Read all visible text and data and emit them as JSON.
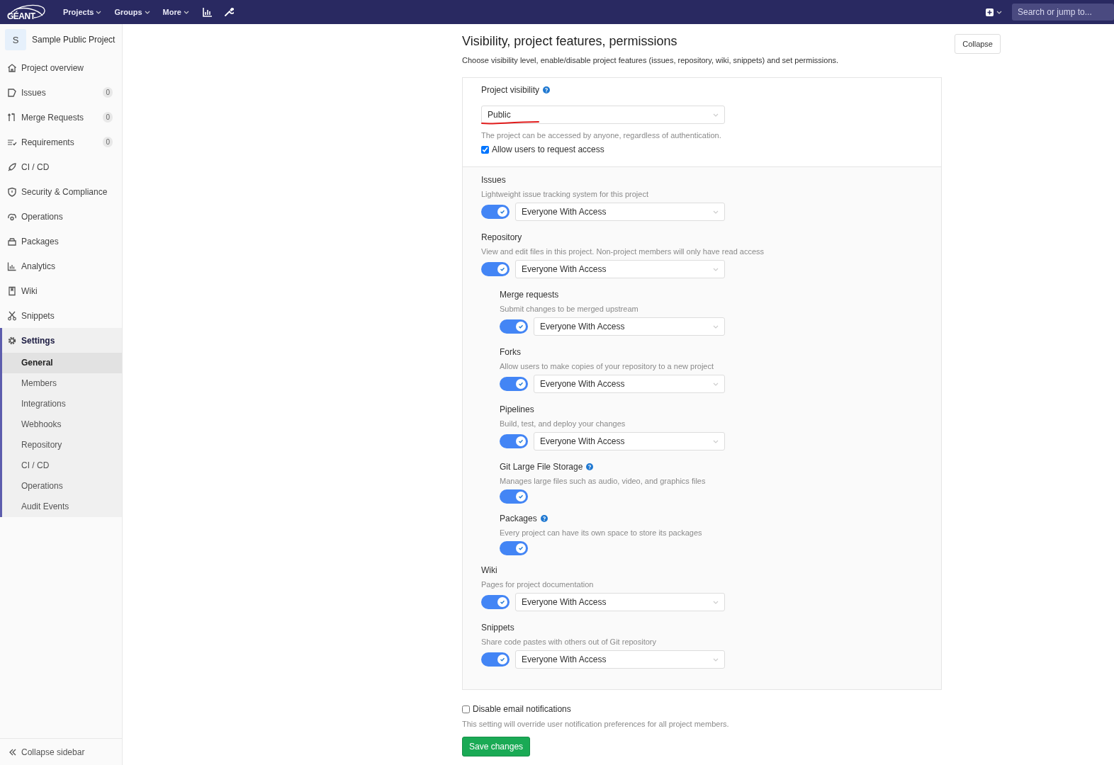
{
  "topbar": {
    "logo": "GÉANT",
    "nav": [
      {
        "label": "Projects"
      },
      {
        "label": "Groups"
      },
      {
        "label": "More"
      }
    ],
    "search": {
      "placeholder": "Search or jump to..."
    }
  },
  "sidebar": {
    "project": {
      "avatar": "S",
      "name": "Sample Public Project"
    },
    "items": [
      {
        "label": "Project overview",
        "selected": false
      },
      {
        "label": "Issues",
        "count": "0",
        "selected": false
      },
      {
        "label": "Merge Requests",
        "count": "0",
        "selected": false
      },
      {
        "label": "Requirements",
        "count": "0",
        "selected": false
      },
      {
        "label": "CI / CD",
        "selected": false
      },
      {
        "label": "Security & Compliance",
        "selected": false
      },
      {
        "label": "Operations",
        "selected": false
      },
      {
        "label": "Packages",
        "selected": false
      },
      {
        "label": "Analytics",
        "selected": false
      },
      {
        "label": "Wiki",
        "selected": false
      },
      {
        "label": "Snippets",
        "selected": false
      },
      {
        "label": "Settings",
        "selected": true,
        "children": [
          {
            "label": "General",
            "selected": true
          },
          {
            "label": "Members",
            "selected": false
          },
          {
            "label": "Integrations",
            "selected": false
          },
          {
            "label": "Webhooks",
            "selected": false
          },
          {
            "label": "Repository",
            "selected": false
          },
          {
            "label": "CI / CD",
            "selected": false
          },
          {
            "label": "Operations",
            "selected": false
          },
          {
            "label": "Audit Events",
            "selected": false
          }
        ]
      }
    ],
    "collapse": "Collapse sidebar"
  },
  "section": {
    "title": "Visibility, project features, permissions",
    "description": "Choose visibility level, enable/disable project features (issues, repository, wiki, snippets) and set permissions.",
    "collapse_button": "Collapse",
    "visibility": {
      "label": "Project visibility",
      "value": "Public",
      "hint": "The project can be accessed by anyone, regardless of authentication.",
      "request_access": {
        "label": "Allow users to request access",
        "checked": true
      }
    },
    "features": [
      {
        "title": "Issues",
        "description": "Lightweight issue tracking system for this project",
        "on": true,
        "access": "Everyone With Access"
      },
      {
        "title": "Repository",
        "description": "View and edit files in this project. Non-project members will only have read access",
        "on": true,
        "access": "Everyone With Access",
        "children": [
          {
            "title": "Merge requests",
            "description": "Submit changes to be merged upstream",
            "on": true,
            "access": "Everyone With Access"
          },
          {
            "title": "Forks",
            "description": "Allow users to make copies of your repository to a new project",
            "on": true,
            "access": "Everyone With Access"
          },
          {
            "title": "Pipelines",
            "description": "Build, test, and deploy your changes",
            "on": true,
            "access": "Everyone With Access"
          },
          {
            "title": "Git Large File Storage",
            "help_icon": true,
            "description": "Manages large files such as audio, video, and graphics files",
            "on": true
          },
          {
            "title": "Packages",
            "help_icon": true,
            "description": "Every project can have its own space to store its packages",
            "on": true
          }
        ]
      },
      {
        "title": "Wiki",
        "description": "Pages for project documentation",
        "on": true,
        "access": "Everyone With Access"
      },
      {
        "title": "Snippets",
        "description": "Share code pastes with others out of Git repository",
        "on": true,
        "access": "Everyone With Access"
      }
    ],
    "email": {
      "label": "Disable email notifications",
      "checked": false,
      "hint": "This setting will override user notification preferences for all project members."
    },
    "save_button": "Save changes"
  }
}
